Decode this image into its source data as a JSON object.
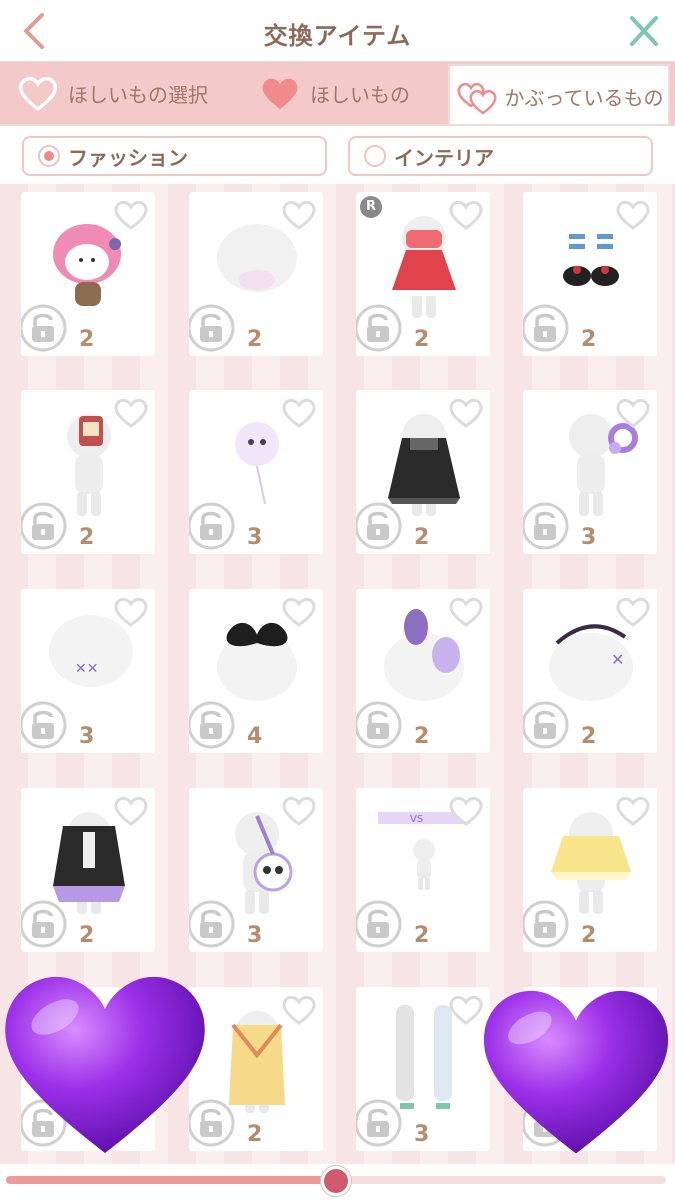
{
  "header": {
    "title": "交換アイテム",
    "back_icon": "chevron-left-icon",
    "close_icon": "close-icon",
    "colors": {
      "back": "#e79a8e",
      "close": "#7fc7b4"
    }
  },
  "tabs": [
    {
      "label": "ほしいもの選択",
      "icon": "heart-outline-icon",
      "active": false
    },
    {
      "label": "ほしいもの",
      "icon": "heart-filled-icon",
      "active": false
    },
    {
      "label": "かぶっているもの",
      "icon": "double-heart-icon",
      "active": true
    }
  ],
  "categories": [
    {
      "label": "ファッション",
      "selected": true
    },
    {
      "label": "インテリア",
      "selected": false
    }
  ],
  "items": [
    {
      "count": "2",
      "art": "pink-hood-character"
    },
    {
      "count": "2",
      "art": "face-mask"
    },
    {
      "count": "2",
      "art": "red-dress",
      "badge": "R"
    },
    {
      "count": "2",
      "art": "striped-socks-shoes"
    },
    {
      "count": "2",
      "art": "red-backpack"
    },
    {
      "count": "3",
      "art": "ghost-balloon"
    },
    {
      "count": "2",
      "art": "black-lolita-dress"
    },
    {
      "count": "3",
      "art": "purple-pacifier"
    },
    {
      "count": "3",
      "art": "stitch-face-sticker"
    },
    {
      "count": "4",
      "art": "black-ribbon"
    },
    {
      "count": "2",
      "art": "purple-ear-hat"
    },
    {
      "count": "2",
      "art": "stitch-headband"
    },
    {
      "count": "2",
      "art": "skeleton-dress"
    },
    {
      "count": "3",
      "art": "skull-bag"
    },
    {
      "count": "2",
      "art": "vs-banner"
    },
    {
      "count": "2",
      "art": "yellow-skirt"
    },
    {
      "count": "",
      "art": "hidden-by-heart"
    },
    {
      "count": "2",
      "art": "yellow-kimono"
    },
    {
      "count": "3",
      "art": "long-gloves-sandals"
    },
    {
      "count": "",
      "art": "hidden-by-heart"
    }
  ],
  "scroll": {
    "position": 0.5
  },
  "colors": {
    "accent": "#ef9a9a",
    "tab_bg": "#f3c9c9",
    "text": "#8a6a5a",
    "count": "#b58c6c",
    "overlay_heart": "#8a2be2"
  }
}
